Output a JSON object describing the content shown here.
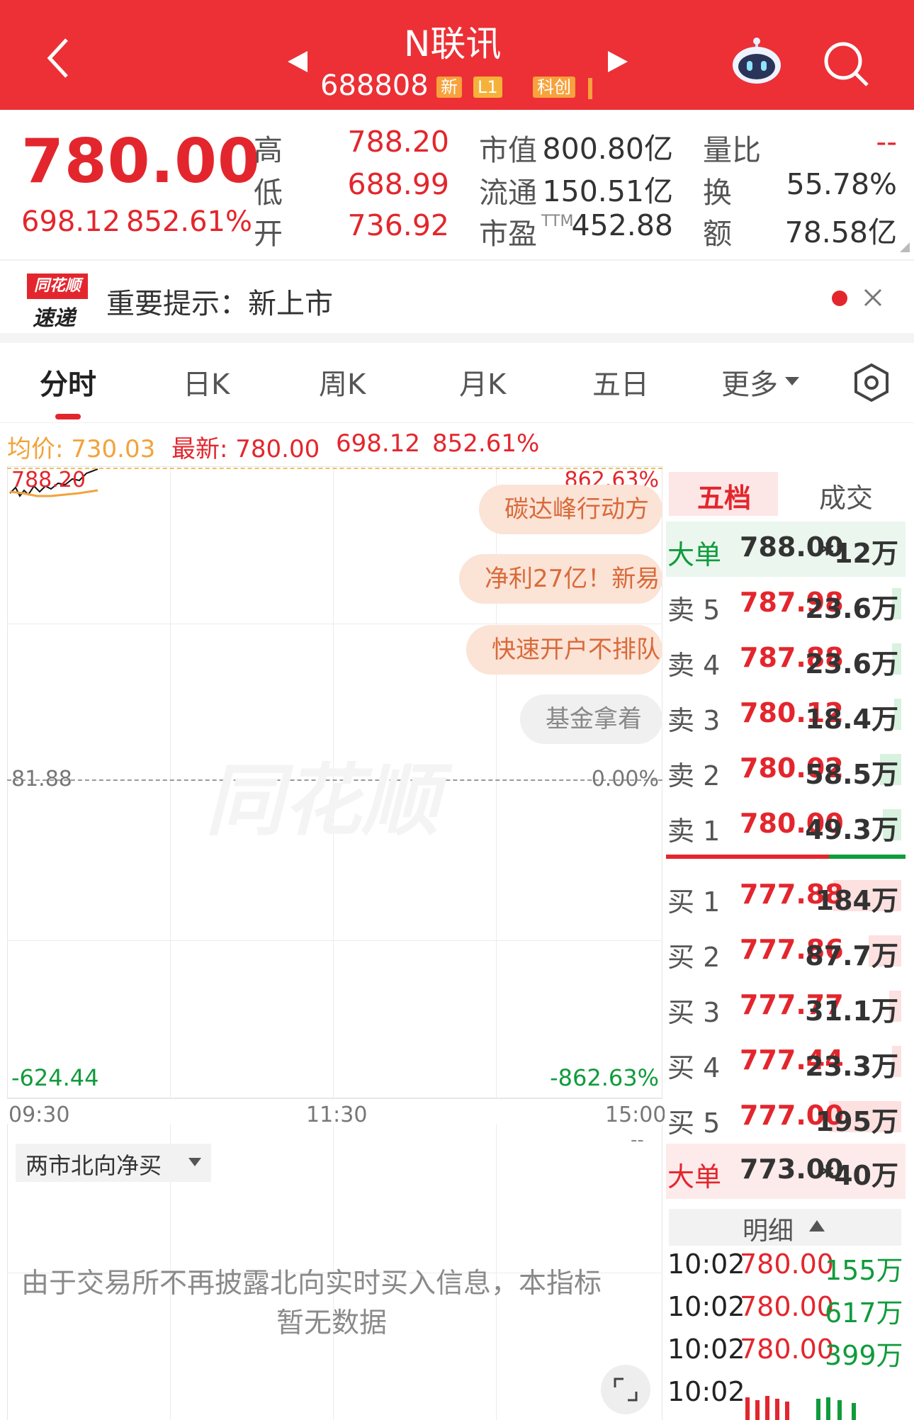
{
  "header": {
    "title": "N联讯",
    "code": "688808",
    "tags": [
      "新",
      "L1",
      "科创"
    ]
  },
  "quote": {
    "price": "780.00",
    "change": "698.12",
    "change_pct": "852.61%",
    "high_label": "高",
    "high": "788.20",
    "low_label": "低",
    "low": "688.99",
    "open_label": "开",
    "open": "736.92",
    "mktcap_label": "市值",
    "mktcap": "800.80亿",
    "float_label": "流通",
    "float": "150.51亿",
    "pe_label": "市盈",
    "pe_sup": "TTM",
    "pe": "452.88",
    "volratio_label": "量比",
    "volratio": "--",
    "turnover_label": "换",
    "turnover": "55.78%",
    "amount_label": "额",
    "amount": "78.58亿"
  },
  "notice": {
    "logo_top": "同花顺",
    "logo_bottom": "速递",
    "text": "重要提示：新上市"
  },
  "tabs": [
    "分时",
    "日K",
    "周K",
    "月K",
    "五日",
    "更多"
  ],
  "avg_line": {
    "avg": "均价: 730.03",
    "latest": "最新: 780.00",
    "change": "698.12",
    "pct": "852.61%"
  },
  "chart": {
    "y_top": "788.20",
    "y_top_pct": "862.63%",
    "y_mid": "81.88",
    "y_mid_pct": "0.00%",
    "y_bot": "-624.44",
    "y_bot_pct": "-862.63%",
    "x_labels": [
      "09:30",
      "11:30",
      "15:00"
    ],
    "watermark": "同花顺",
    "news": [
      "碳达峰行动方案",
      "净利27亿！新易",
      "快速开户不排队",
      "基金拿着基"
    ]
  },
  "order_book": {
    "tabs": [
      "五档",
      "成交"
    ],
    "big_sell": {
      "label": "大单",
      "price": "788.00",
      "vol": "*12万"
    },
    "asks": [
      {
        "label": "卖 5",
        "price": "787.98",
        "vol": "23.6万",
        "bar": 0.04
      },
      {
        "label": "卖 4",
        "price": "787.88",
        "vol": "23.6万",
        "bar": 0.04
      },
      {
        "label": "卖 3",
        "price": "780.12",
        "vol": "18.4万",
        "bar": 0.03
      },
      {
        "label": "卖 2",
        "price": "780.02",
        "vol": "58.5万",
        "bar": 0.09
      },
      {
        "label": "卖 1",
        "price": "780.00",
        "vol": "49.3万",
        "bar": 0.08
      }
    ],
    "bids": [
      {
        "label": "买 1",
        "price": "777.88",
        "vol": "184万",
        "bar": 0.29
      },
      {
        "label": "买 2",
        "price": "777.86",
        "vol": "87.7万",
        "bar": 0.14
      },
      {
        "label": "买 3",
        "price": "777.77",
        "vol": "31.1万",
        "bar": 0.05
      },
      {
        "label": "买 4",
        "price": "777.44",
        "vol": "23.3万",
        "bar": 0.04
      },
      {
        "label": "买 5",
        "price": "777.00",
        "vol": "195万",
        "bar": 0.31
      }
    ],
    "big_buy": {
      "label": "大单",
      "price": "773.00",
      "vol": "*40万"
    },
    "detail_label": "明细",
    "details": [
      {
        "time": "10:02",
        "price": "780.00",
        "vol": "155万"
      },
      {
        "time": "10:02",
        "price": "780.00",
        "vol": "617万"
      },
      {
        "time": "10:02",
        "price": "780.00",
        "vol": "399万"
      },
      {
        "time": "10:02",
        "price": "",
        "vol": ""
      }
    ]
  },
  "indicator": {
    "dropdown": "两市北向净买",
    "value": "--",
    "message_line1": "由于交易所不再披露北向实时买入信息，本指标",
    "message_line2": "暂无数据"
  },
  "colors": {
    "header": "#ec3036",
    "up": "#e3262d",
    "down": "#109b3c",
    "accent_orange": "#f2a33a"
  }
}
